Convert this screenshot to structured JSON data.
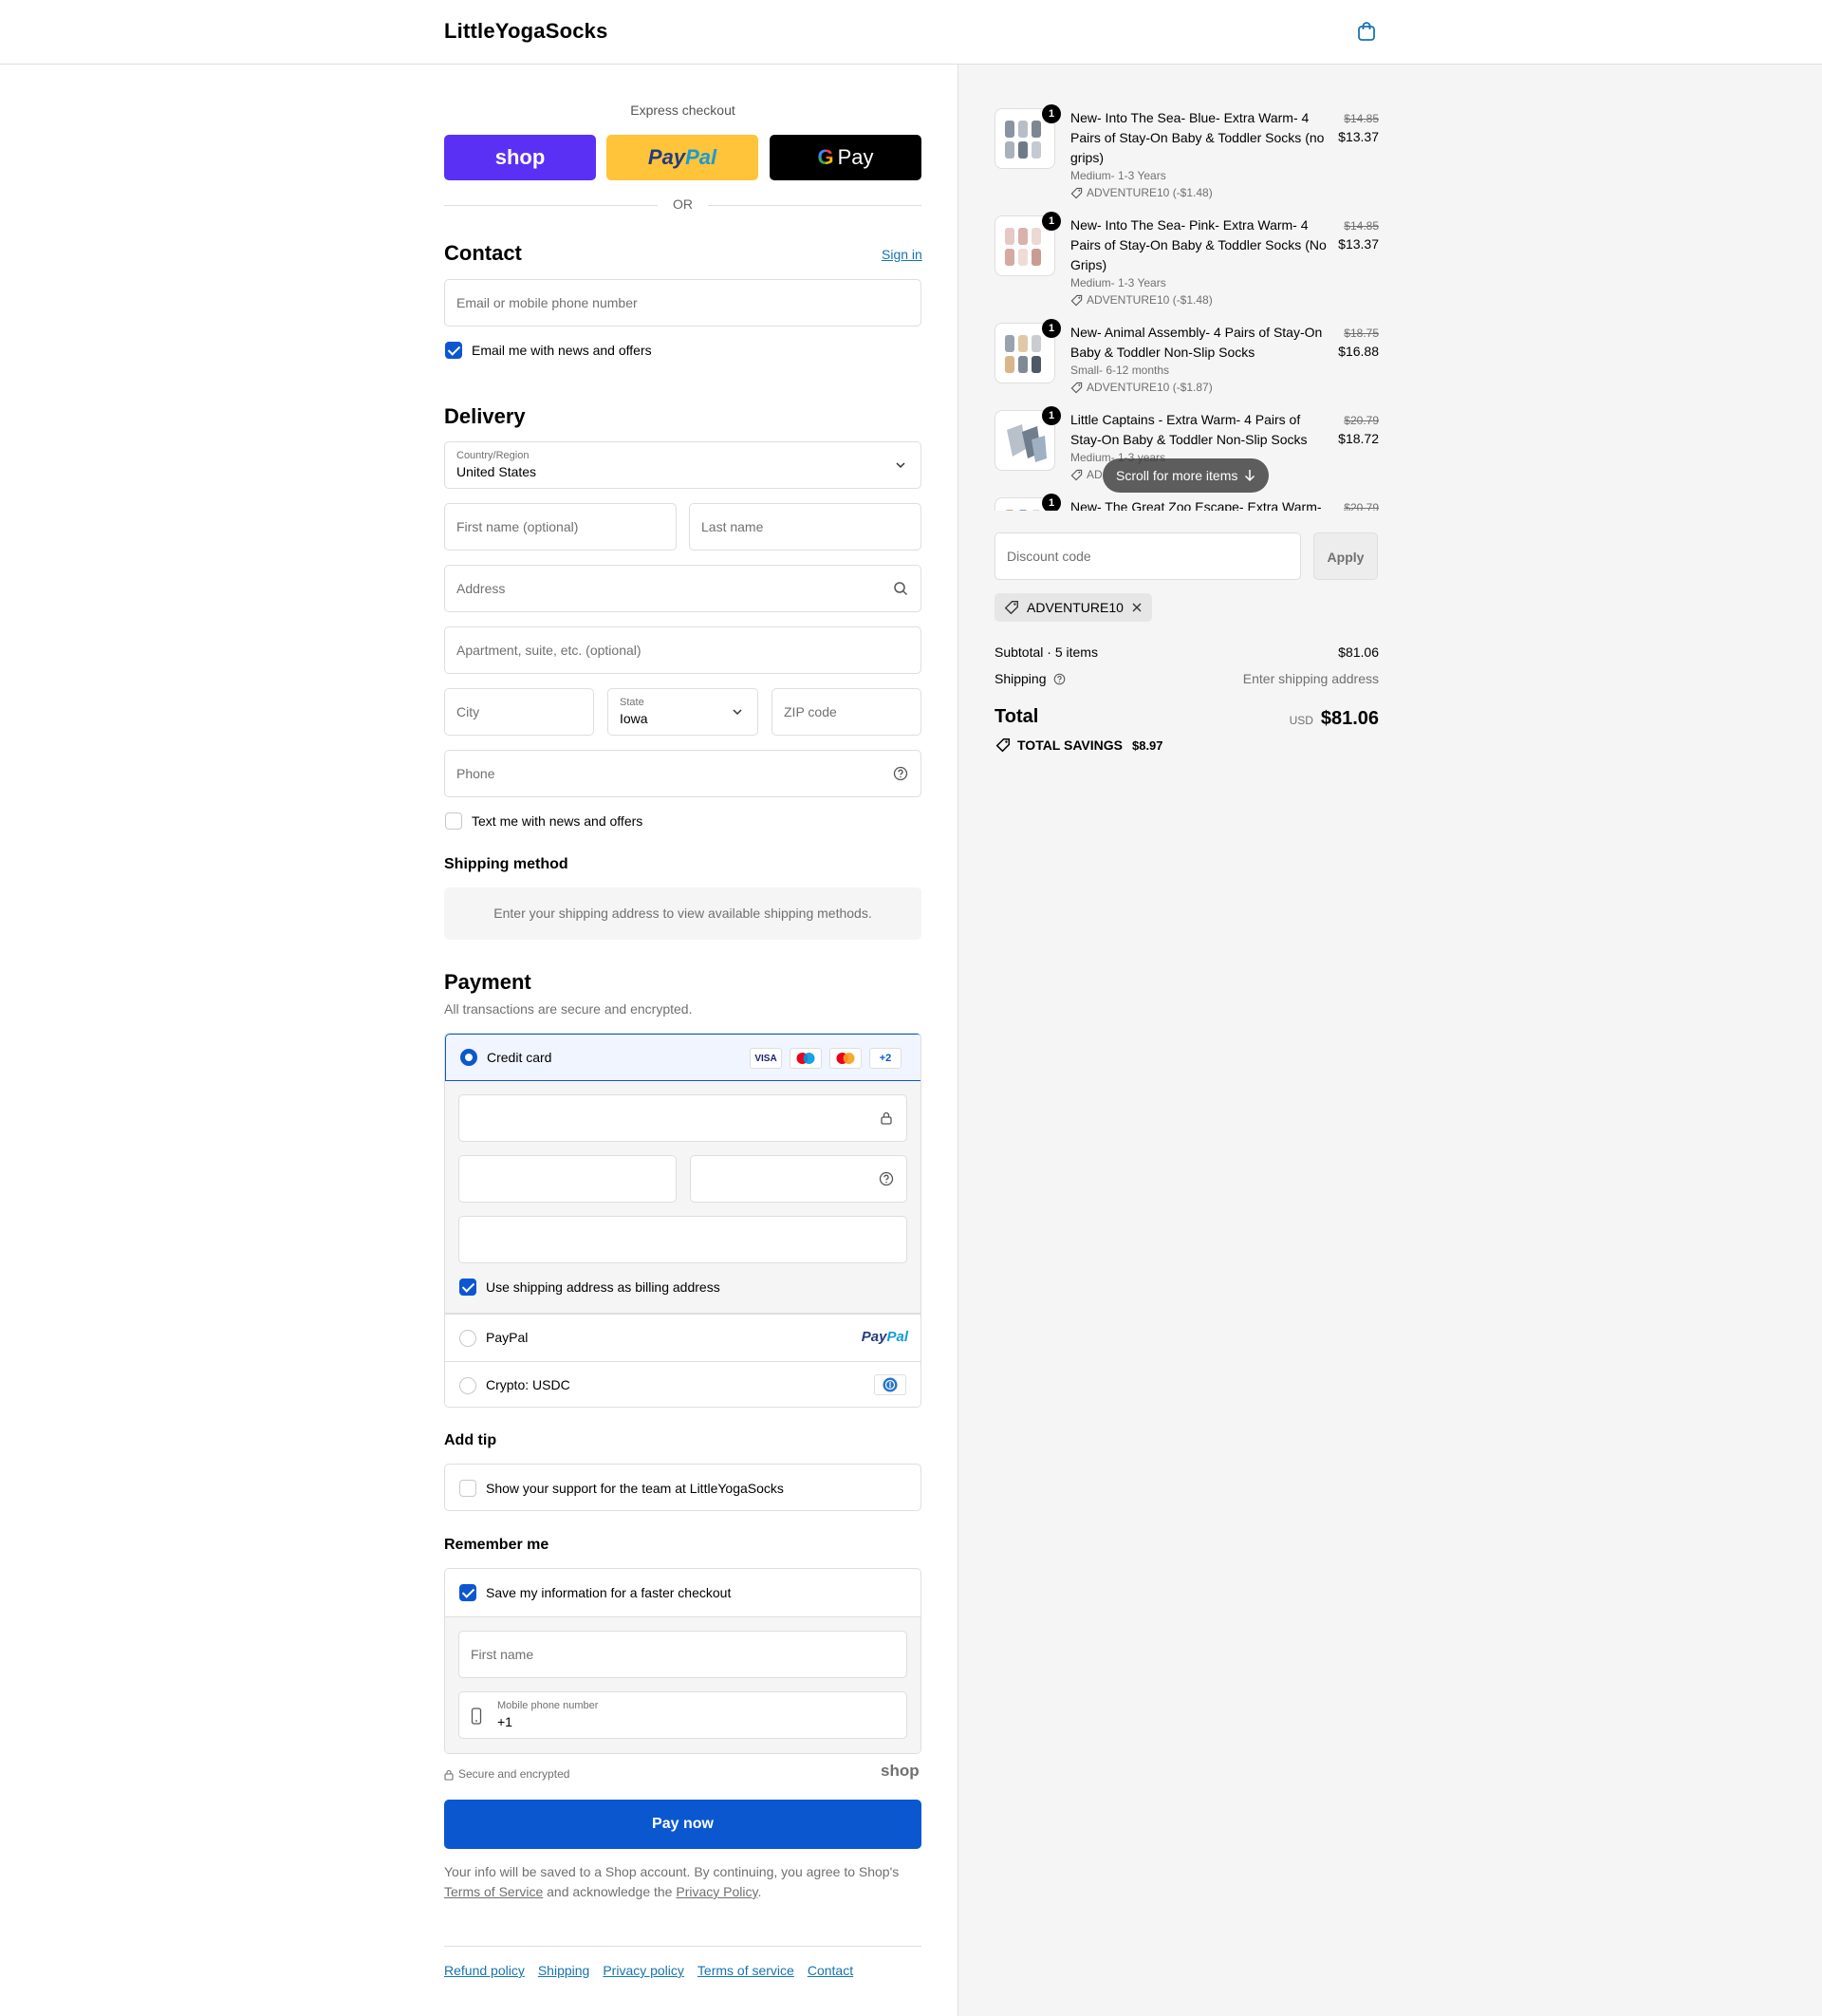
{
  "header": {
    "brand": "LittleYogaSocks"
  },
  "express": {
    "label": "Express checkout",
    "shop": "shop",
    "paypal_a": "Pay",
    "paypal_b": "Pal",
    "gpay": "Pay",
    "or": "OR"
  },
  "contact": {
    "title": "Contact",
    "sign_in": "Sign in",
    "email_placeholder": "Email or mobile phone number",
    "email_news": "Email me with news and offers"
  },
  "delivery": {
    "title": "Delivery",
    "country_label": "Country/Region",
    "country_value": "United States",
    "first_name": "First name (optional)",
    "last_name": "Last name",
    "address": "Address",
    "apartment": "Apartment, suite, etc. (optional)",
    "city": "City",
    "state_label": "State",
    "state_value": "Iowa",
    "zip": "ZIP code",
    "phone": "Phone",
    "text_news": "Text me with news and offers"
  },
  "shipping_method": {
    "title": "Shipping method",
    "info": "Enter your shipping address to view available shipping methods."
  },
  "payment": {
    "title": "Payment",
    "subtitle": "All transactions are secure and encrypted.",
    "credit_card": "Credit card",
    "visa": "VISA",
    "more_cards": "+2",
    "billing_same": "Use shipping address as billing address",
    "paypal": "PayPal",
    "paypal_logo_a": "Pay",
    "paypal_logo_b": "Pal",
    "crypto": "Crypto: USDC"
  },
  "tip": {
    "title": "Add tip",
    "label": "Show your support for the team at LittleYogaSocks"
  },
  "remember": {
    "title": "Remember me",
    "save_label": "Save my information for a faster checkout",
    "first_name": "First name",
    "mobile_label": "Mobile phone number",
    "mobile_value": "+1"
  },
  "secure": {
    "label": "Secure and encrypted",
    "shop_logo": "shop"
  },
  "pay_now": "Pay now",
  "fine_print": {
    "text1": "Your info will be saved to a Shop account. By continuing, you agree to Shop's",
    "terms": "Terms of Service",
    "text2": "and acknowledge the",
    "privacy": "Privacy Policy",
    "text3": "."
  },
  "footer": {
    "links": [
      "Refund policy",
      "Shipping",
      "Privacy policy",
      "Terms of service",
      "Contact"
    ]
  },
  "order": {
    "items": [
      {
        "qty": "1",
        "name": "New- Into The Sea- Blue- Extra Warm- 4 Pairs of Stay-On Baby & Toddler Socks (no grips)",
        "variant": "Medium- 1-3 Years",
        "discount": "ADVENTURE10 (-$1.48)",
        "old_price": "$14.85",
        "price": "$13.37"
      },
      {
        "qty": "1",
        "name": "New- Into The Sea- Pink- Extra Warm- 4 Pairs of Stay-On Baby & Toddler Socks (No Grips)",
        "variant": "Medium- 1-3 Years",
        "discount": "ADVENTURE10 (-$1.48)",
        "old_price": "$14.85",
        "price": "$13.37"
      },
      {
        "qty": "1",
        "name": "New- Animal Assembly- 4 Pairs of Stay-On Baby & Toddler Non-Slip Socks",
        "variant": "Small- 6-12 months",
        "discount": "ADVENTURE10 (-$1.87)",
        "old_price": "$18.75",
        "price": "$16.88"
      },
      {
        "qty": "1",
        "name": "Little Captains - Extra Warm- 4 Pairs of Stay-On Baby & Toddler Non-Slip Socks",
        "variant": "Medium- 1-3 years",
        "discount": "AD",
        "old_price": "$20.79",
        "price": "$18.72"
      },
      {
        "qty": "1",
        "name": "New- The Great Zoo Escape- Extra Warm-",
        "old_price": "$20.79"
      }
    ],
    "scroll_hint": "Scroll for more items",
    "discount_placeholder": "Discount code",
    "apply": "Apply",
    "applied_code": "ADVENTURE10",
    "subtotal_label": "Subtotal · 5 items",
    "subtotal_value": "$81.06",
    "shipping_label": "Shipping",
    "shipping_value": "Enter shipping address",
    "total_label": "Total",
    "currency": "USD",
    "total_value": "$81.06",
    "savings_label": "TOTAL SAVINGS",
    "savings_value": "$8.97"
  },
  "colors": {
    "accent": "#0b57d0",
    "link": "#1773b0",
    "shop_purple": "#5a31f4",
    "paypal_yellow": "#ffc439",
    "paypal_dark": "#253b80",
    "paypal_light": "#179bd7"
  }
}
